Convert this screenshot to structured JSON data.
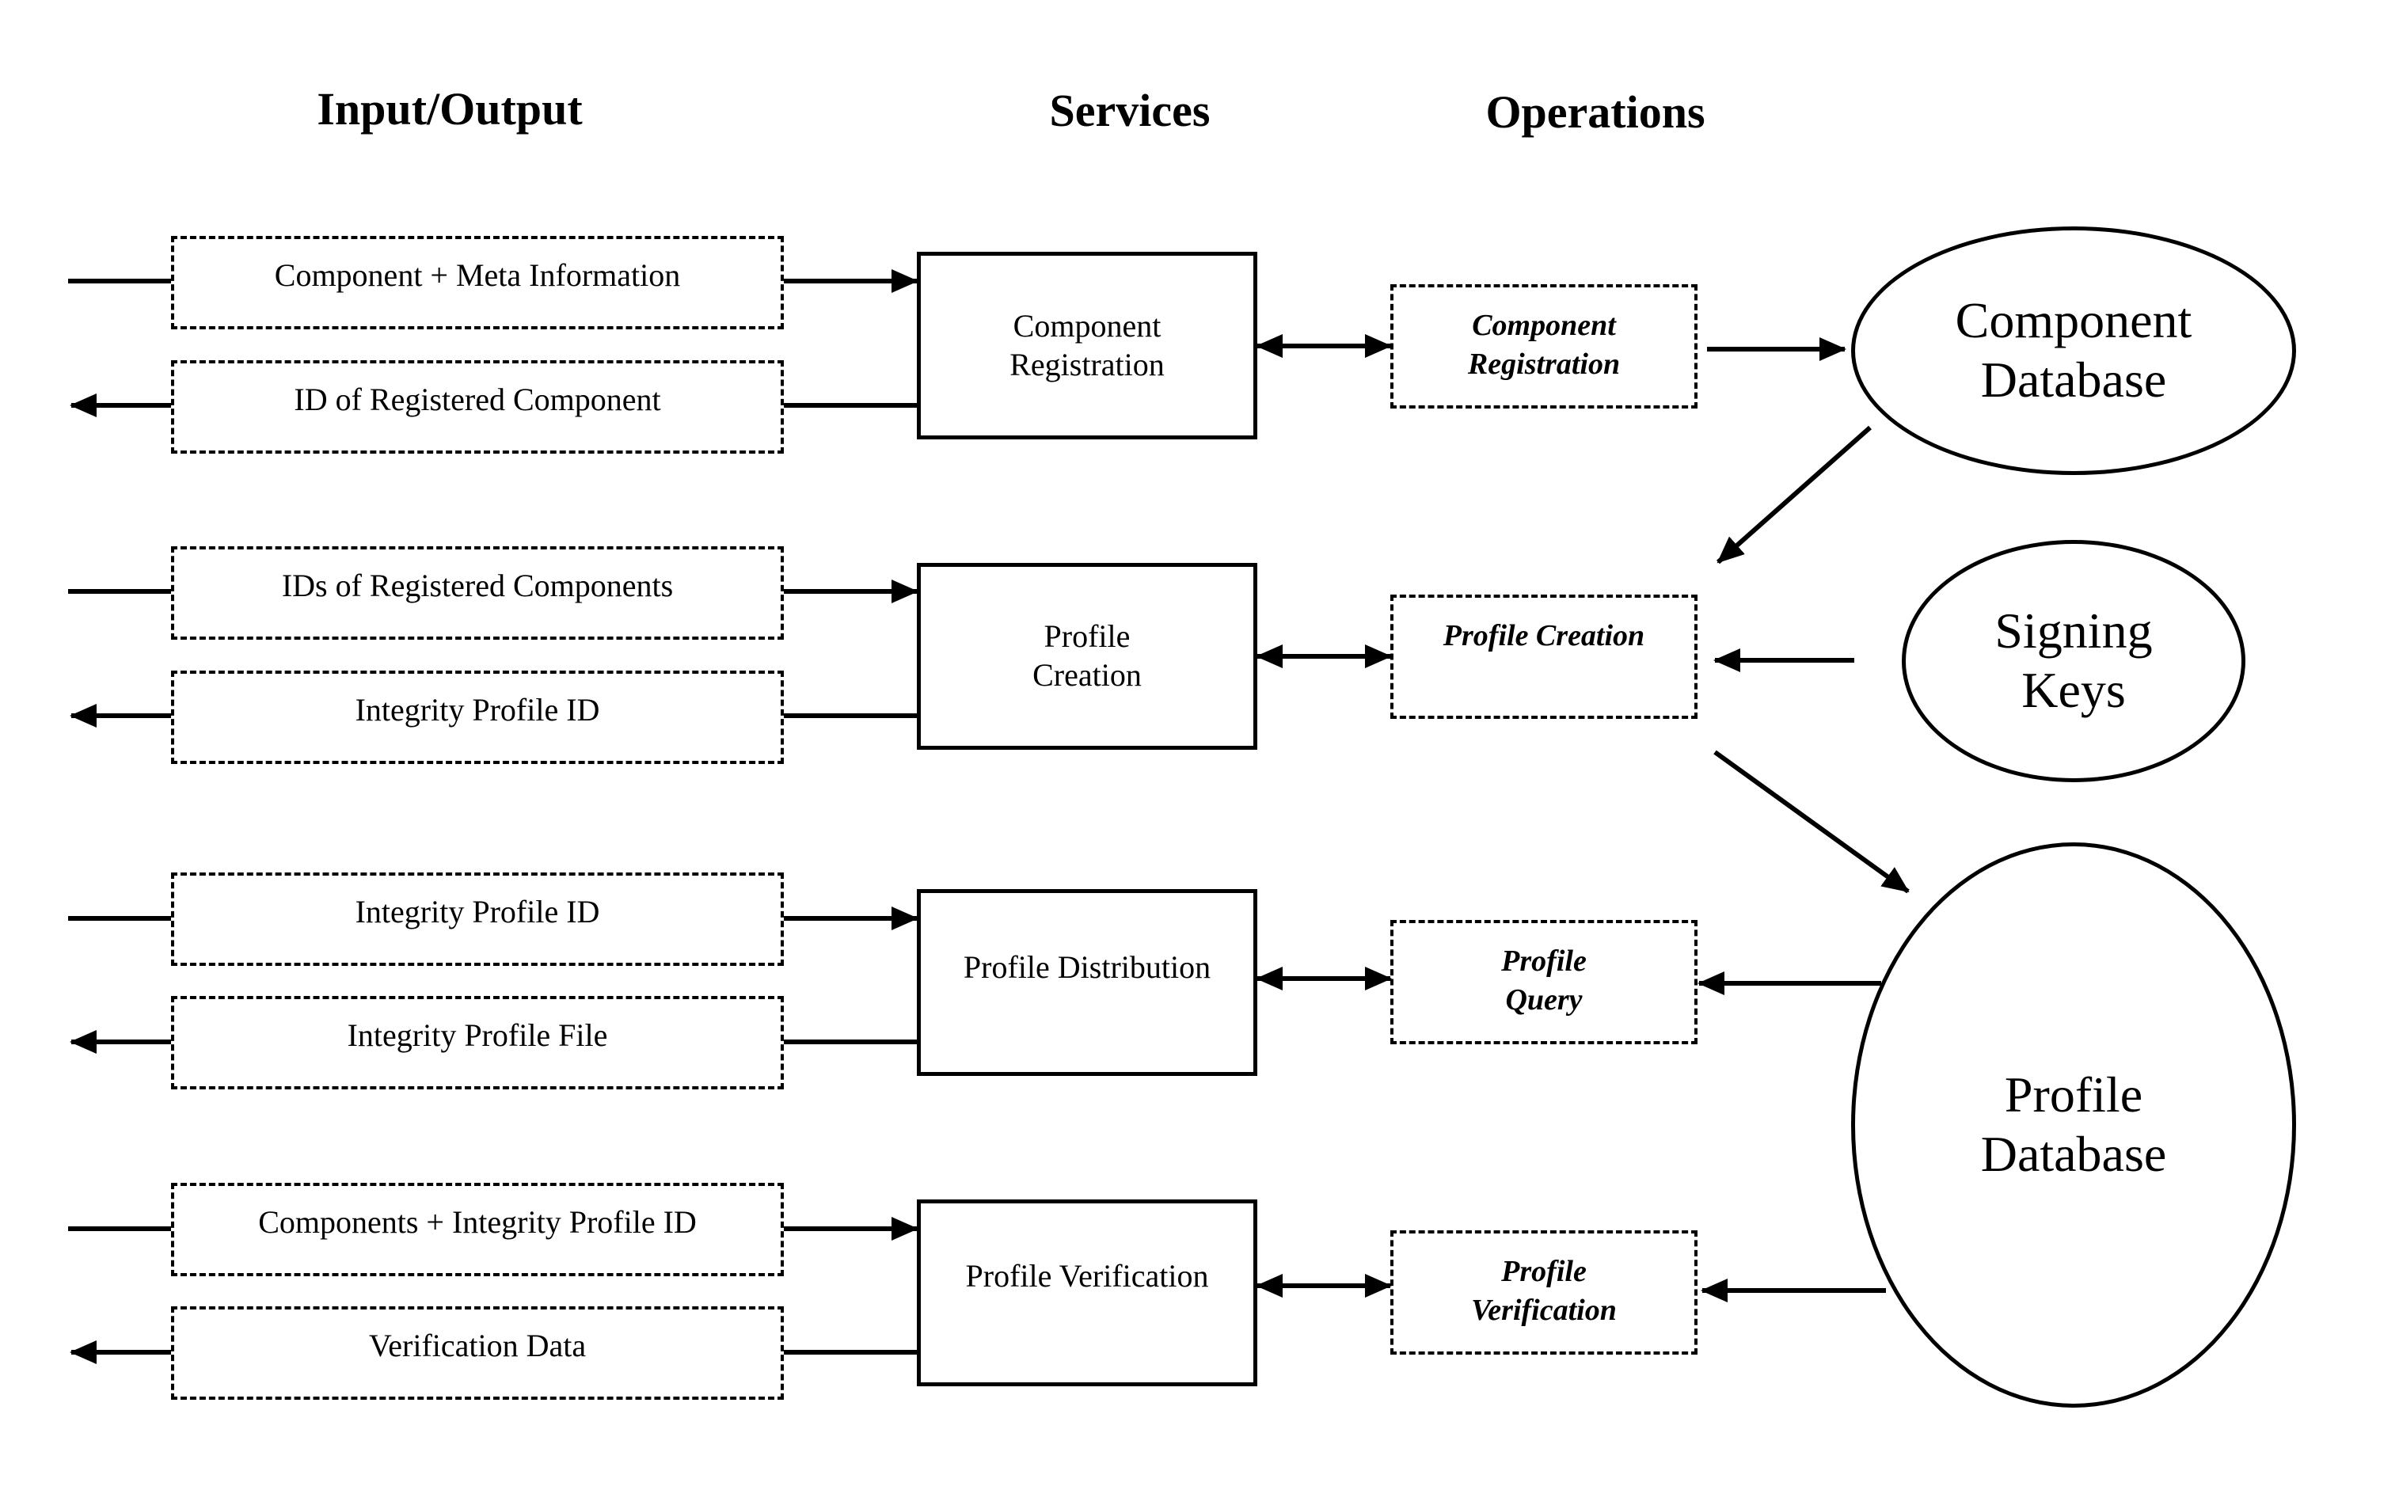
{
  "headers": {
    "io": "Input/Output",
    "services": "Services",
    "operations": "Operations"
  },
  "rows": [
    {
      "input": "Component + Meta Information",
      "output": "ID of Registered Component",
      "service": "Component\nRegistration",
      "operation": "Component\nRegistration"
    },
    {
      "input": "IDs of Registered Components",
      "output": "Integrity Profile ID",
      "service": "Profile\nCreation",
      "operation": "Profile Creation"
    },
    {
      "input": "Integrity Profile ID",
      "output": "Integrity Profile File",
      "service": "Profile Distribution",
      "operation": "Profile\nQuery"
    },
    {
      "input": "Components + Integrity Profile ID",
      "output": "Verification Data",
      "service": "Profile Verification",
      "operation": "Profile\nVerification"
    }
  ],
  "stores": {
    "component_db": "Component\nDatabase",
    "signing_keys": "Signing\nKeys",
    "profile_db": "Profile\nDatabase"
  },
  "flows": [
    {
      "from": "Component Registration (operation)",
      "to": "Component Database",
      "direction": "one-way"
    },
    {
      "from": "Component Database",
      "to": "Profile Creation (operation)",
      "direction": "one-way"
    },
    {
      "from": "Signing Keys",
      "to": "Profile Creation (operation)",
      "direction": "one-way"
    },
    {
      "from": "Profile Creation (operation)",
      "to": "Profile Database",
      "direction": "one-way"
    },
    {
      "from": "Profile Database",
      "to": "Profile Query (operation)",
      "direction": "one-way"
    },
    {
      "from": "Profile Database",
      "to": "Profile Verification (operation)",
      "direction": "one-way"
    },
    {
      "from": "Services",
      "to": "Operations",
      "direction": "two-way"
    }
  ]
}
